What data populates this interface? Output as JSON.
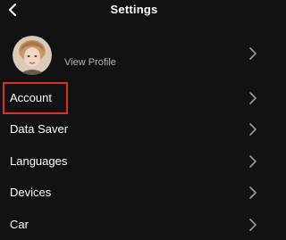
{
  "header": {
    "title": "Settings",
    "back_icon": "chevron-left-icon"
  },
  "profile": {
    "view_profile_label": "View Profile",
    "avatar_icon": "avatar-photo"
  },
  "menu": {
    "items": [
      {
        "label": "Account",
        "highlighted": true
      },
      {
        "label": "Data Saver"
      },
      {
        "label": "Languages"
      },
      {
        "label": "Devices"
      },
      {
        "label": "Car"
      }
    ]
  },
  "colors": {
    "background": "#121212",
    "text": "#ffffff",
    "secondary_text": "#b3b3b3",
    "chevron": "#9a9a9a",
    "highlight": "#e0301e"
  }
}
